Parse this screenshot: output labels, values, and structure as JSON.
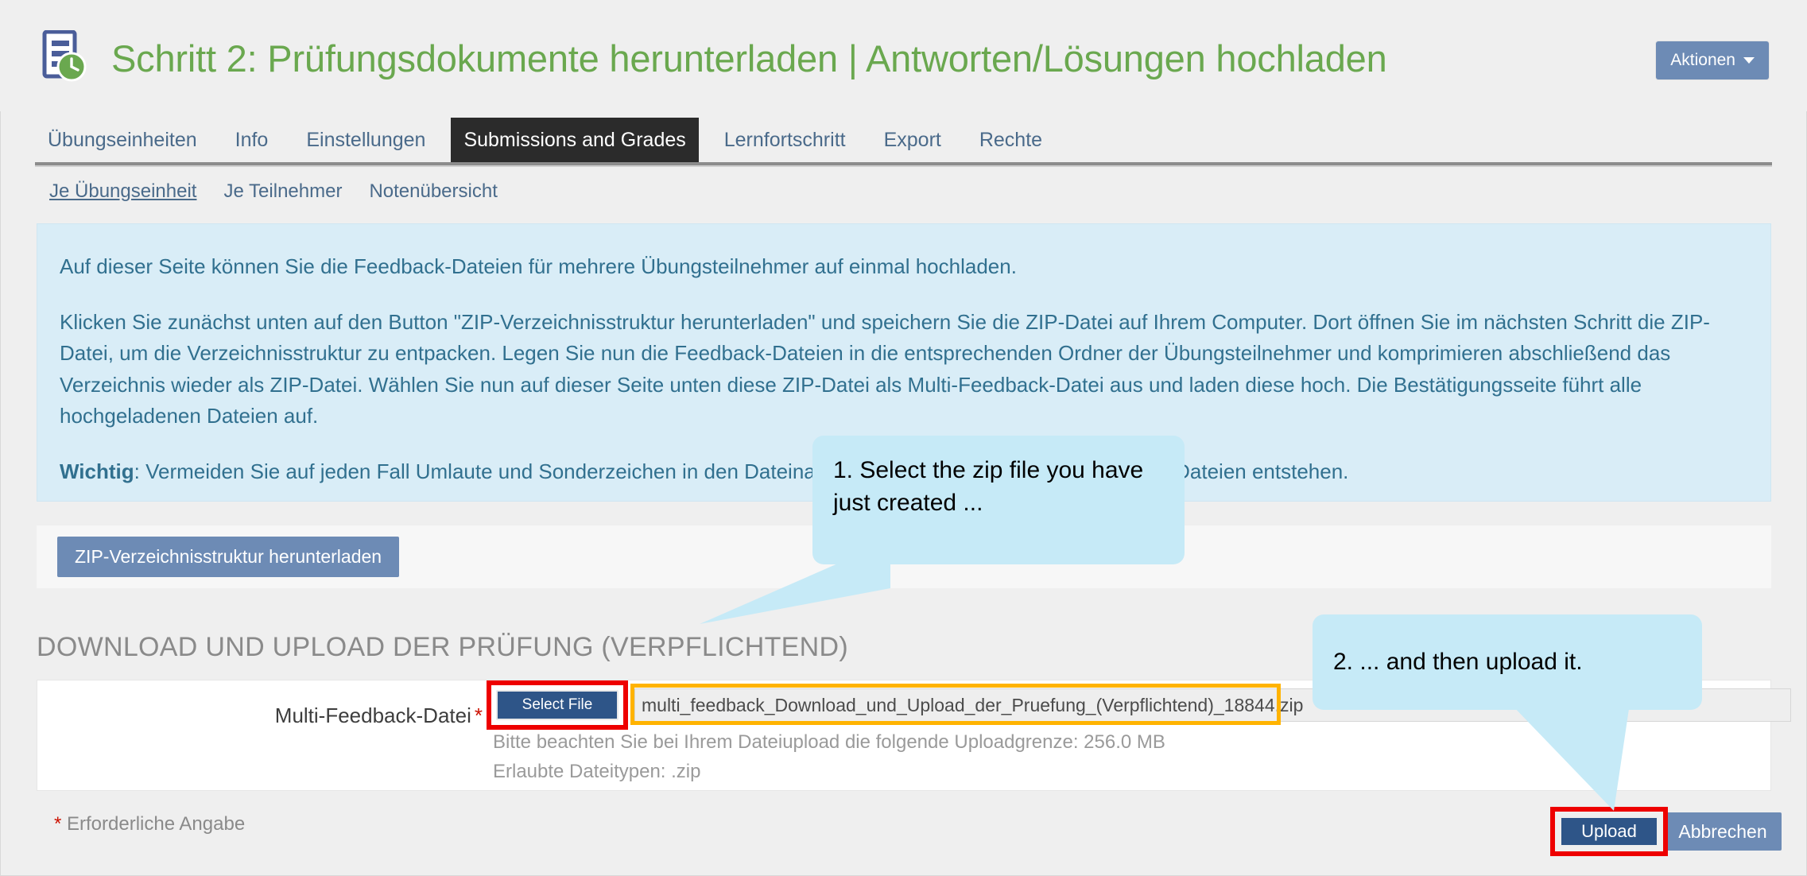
{
  "header": {
    "title": "Schritt 2: Prüfungsdokumente herunterladen | Antworten/Lösungen hochladen",
    "icon": "document-clock-icon",
    "actions_label": "Aktionen",
    "title_color": "#6aa84f",
    "actions_bg": "#6d8bb5"
  },
  "tabs": [
    {
      "label": "Übungseinheiten",
      "active": false
    },
    {
      "label": "Info",
      "active": false
    },
    {
      "label": "Einstellungen",
      "active": false
    },
    {
      "label": "Submissions and Grades",
      "active": true
    },
    {
      "label": "Lernfortschritt",
      "active": false
    },
    {
      "label": "Export",
      "active": false
    },
    {
      "label": "Rechte",
      "active": false
    }
  ],
  "subtabs": [
    {
      "label": "Je Übungseinheit",
      "active": true
    },
    {
      "label": "Je Teilnehmer",
      "active": false
    },
    {
      "label": "Notenübersicht",
      "active": false
    }
  ],
  "infobox": {
    "background": "#d9edf7",
    "text_color": "#31708f",
    "paragraph_1": "Auf dieser Seite können Sie die Feedback-Dateien für mehrere Übungsteilnehmer auf einmal hochladen.",
    "paragraph_2": "Klicken Sie zunächst unten auf den Button \"ZIP-Verzeichnisstruktur herunterladen\" und speichern Sie die ZIP-Datei auf Ihrem Computer. Dort öffnen Sie im nächsten Schritt die ZIP-Datei, um die Verzeichnisstruktur zu entpacken. Legen Sie nun die Feedback-Dateien in die entsprechenden Ordner der Übungsteilnehmer und komprimieren abschließend das Verzeichnis wieder als ZIP-Datei. Wählen Sie nun auf dieser Seite unten diese ZIP-Datei als Multi-Feedback-Datei aus und laden diese hoch. Die Bestätigungsseite führt alle hochgeladenen Dateien auf.",
    "paragraph_3_bold": "Wichtig",
    "paragraph_3": ": Vermeiden Sie auf jeden Fall Umlaute und Sonderzeichen in den Dateinamen, da sonst eine Fehlzuordnung der Dateien entstehen."
  },
  "download_strip": {
    "zip_download_label": "ZIP-Verzeichnisstruktur herunterladen"
  },
  "section": {
    "heading": "DOWNLOAD UND UPLOAD DER PRÜFUNG (VERPFLICHTEND)"
  },
  "form": {
    "field_label": "Multi-Feedback-Datei",
    "required_marker": "*",
    "select_file_label": "Select File",
    "file_value": "multi_feedback_Download_und_Upload_der_Pruefung_(Verpflichtend)_18844.zip",
    "hint_upload_limit": "Bitte beachten Sie bei Ihrem Dateiupload die folgende Uploadgrenze: 256.0 MB",
    "hint_filetypes": "Erlaubte Dateitypen: .zip"
  },
  "footer": {
    "required_star": "*",
    "required_note": "Erforderliche Angabe",
    "upload_label": "Upload",
    "cancel_label": "Abbrechen"
  },
  "callouts": [
    {
      "text": "1. Select the zip file you have just created ...",
      "bg": "#c6eaf7"
    },
    {
      "text": "2. ... and then upload it.",
      "bg": "#c6eaf7"
    }
  ],
  "highlights": {
    "red": "#ee0000",
    "orange": "#ffb300"
  }
}
